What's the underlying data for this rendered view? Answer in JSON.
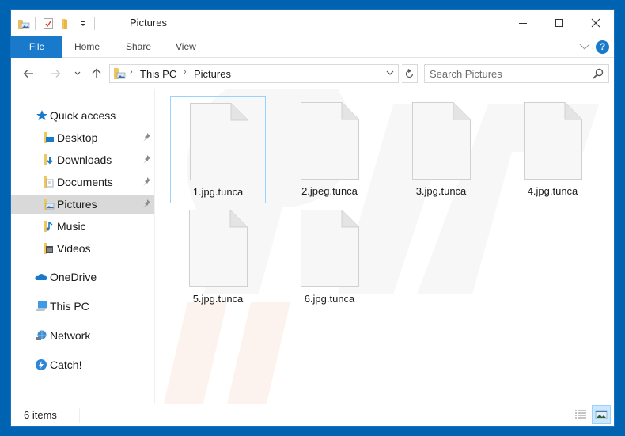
{
  "window": {
    "title": "Pictures",
    "controls": {
      "minimize": "minimize",
      "maximize": "maximize",
      "close": "close"
    }
  },
  "quick_access_toolbar": {
    "icons": [
      "pictures-folder-icon",
      "properties-icon",
      "new-folder-icon",
      "customize-dropdown-icon"
    ]
  },
  "ribbon": {
    "tabs": [
      {
        "label": "File",
        "active": true
      },
      {
        "label": "Home"
      },
      {
        "label": "Share"
      },
      {
        "label": "View"
      }
    ],
    "help_label": "?"
  },
  "navbar": {
    "breadcrumb": [
      "This PC",
      "Pictures"
    ],
    "search": {
      "placeholder": "Search Pictures",
      "value": ""
    }
  },
  "sidebar": {
    "quick_access": {
      "label": "Quick access"
    },
    "items": [
      {
        "label": "Desktop",
        "icon": "desktop-folder-icon",
        "pinned": true
      },
      {
        "label": "Downloads",
        "icon": "downloads-folder-icon",
        "pinned": true
      },
      {
        "label": "Documents",
        "icon": "documents-folder-icon",
        "pinned": true
      },
      {
        "label": "Pictures",
        "icon": "pictures-folder-icon",
        "pinned": true,
        "selected": true
      },
      {
        "label": "Music",
        "icon": "music-folder-icon"
      },
      {
        "label": "Videos",
        "icon": "videos-folder-icon"
      }
    ],
    "roots": [
      {
        "label": "OneDrive",
        "icon": "onedrive-icon"
      },
      {
        "label": "This PC",
        "icon": "this-pc-icon"
      },
      {
        "label": "Network",
        "icon": "network-icon"
      },
      {
        "label": "Catch!",
        "icon": "catch-icon"
      }
    ]
  },
  "files": [
    {
      "name": "1.jpg.tunca",
      "focused": true
    },
    {
      "name": "2.jpeg.tunca"
    },
    {
      "name": "3.jpg.tunca"
    },
    {
      "name": "4.jpg.tunca"
    },
    {
      "name": "5.jpg.tunca"
    },
    {
      "name": "6.jpg.tunca"
    }
  ],
  "statusbar": {
    "item_count": "6 items",
    "views": [
      "details-view",
      "large-icons-view"
    ],
    "active_view": "large-icons-view"
  },
  "colors": {
    "desktop_blue": "#0063b1",
    "accent": "#1979ca",
    "selection": "#cce8ff"
  }
}
